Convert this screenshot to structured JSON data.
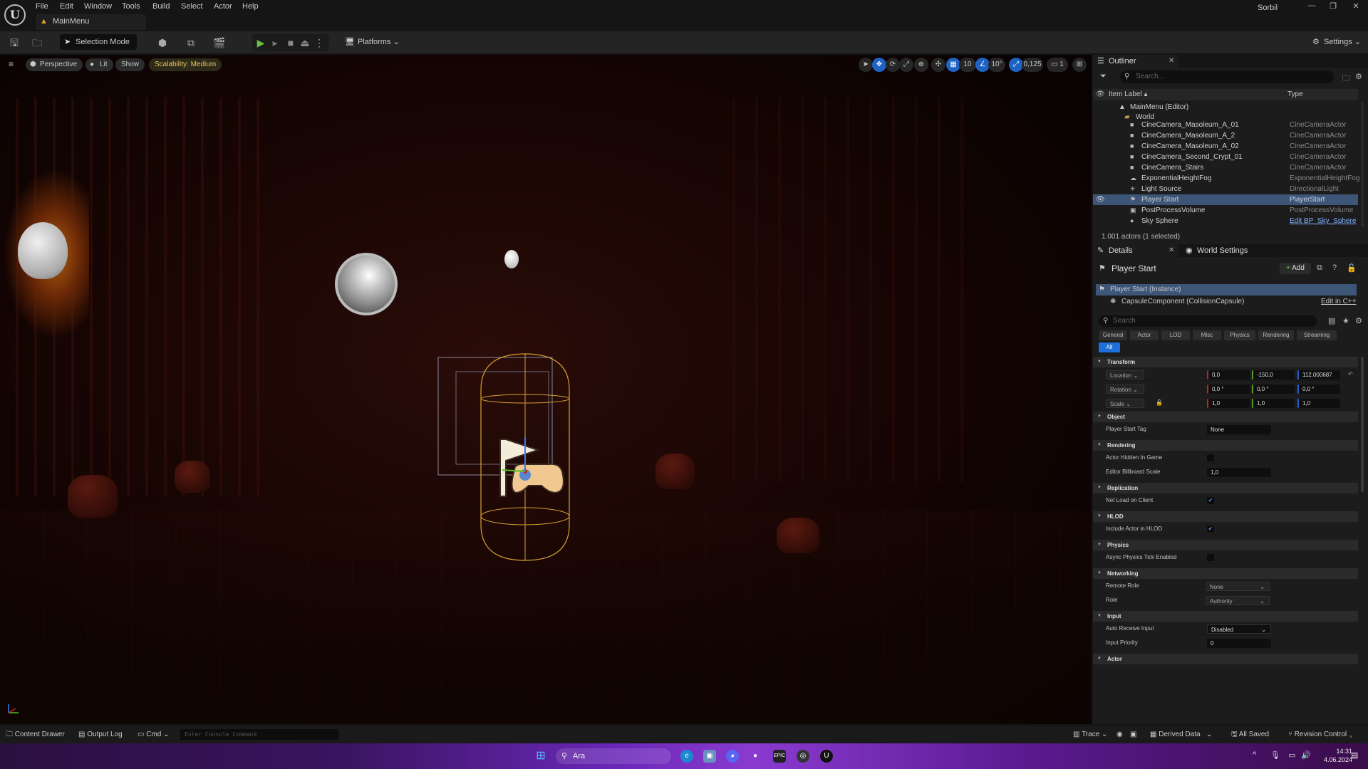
{
  "app": {
    "title": "MainMenu",
    "user": "Sorbil"
  },
  "menu": [
    "File",
    "Edit",
    "Window",
    "Tools",
    "Build",
    "Select",
    "Actor",
    "Help"
  ],
  "window_controls": {
    "minimize": "—",
    "restore": "❐",
    "close": "✕"
  },
  "toolbar": {
    "selection_mode": "Selection Mode",
    "platforms": "Platforms",
    "settings": "Settings"
  },
  "viewport": {
    "view_mode": "Perspective",
    "lighting": "Lit",
    "show": "Show",
    "scalability": "Scalability: Medium",
    "grid_snap": "10",
    "rotation_snap": "10°",
    "scale_snap": "0,125",
    "camera_speed": "1"
  },
  "outliner": {
    "tab": "Outliner",
    "search_placeholder": "Search...",
    "col_label": "Item Label",
    "col_type": "Type",
    "root": "MainMenu (Editor)",
    "folder": "World",
    "rows": [
      {
        "name": "CineCamera_Masoleum_A_01",
        "type": "CineCameraActor"
      },
      {
        "name": "CineCamera_Masoleum_A_2",
        "type": "CineCameraActor"
      },
      {
        "name": "CineCamera_Masoleum_A_02",
        "type": "CineCameraActor"
      },
      {
        "name": "CineCamera_Second_Crypt_01",
        "type": "CineCameraActor"
      },
      {
        "name": "CineCamera_Stairs",
        "type": "CineCameraActor"
      },
      {
        "name": "ExponentialHeightFog",
        "type": "ExponentialHeightFog"
      },
      {
        "name": "Light Source",
        "type": "DirectionalLight"
      },
      {
        "name": "Player Start",
        "type": "PlayerStart",
        "selected": true
      },
      {
        "name": "PostProcessVolume",
        "type": "PostProcessVolume"
      },
      {
        "name": "Sky Sphere",
        "type": "Edit BP_Sky_Sphere",
        "link": true
      }
    ],
    "status": "1.001 actors (1 selected)"
  },
  "details": {
    "tab": "Details",
    "tab2": "World Settings",
    "actor_name": "Player Start",
    "add_label": "Add",
    "instance": "Player Start (Instance)",
    "component": "CapsuleComponent (CollisionCapsule)",
    "edit_cpp": "Edit in C++",
    "search_placeholder": "Search",
    "categories": [
      "General",
      "Actor",
      "LOD",
      "Misc",
      "Physics",
      "Rendering",
      "Streaming"
    ],
    "category_all": "All",
    "transform": {
      "section": "Transform",
      "location_label": "Location",
      "location": [
        "0,0",
        "-150,0",
        "112,000687"
      ],
      "rotation_label": "Rotation",
      "rotation": [
        "0,0 °",
        "0,0 °",
        "0,0 °"
      ],
      "scale_label": "Scale",
      "scale": [
        "1,0",
        "1,0",
        "1,0"
      ]
    },
    "object": {
      "section": "Object",
      "player_start_tag_label": "Player Start Tag",
      "player_start_tag": "None"
    },
    "rendering": {
      "section": "Rendering",
      "hidden_label": "Actor Hidden In Game",
      "hidden": false,
      "billboard_label": "Editor Billboard Scale",
      "billboard": "1,0"
    },
    "replication": {
      "section": "Replication",
      "net_load_label": "Net Load on Client",
      "net_load": true
    },
    "hlod": {
      "section": "HLOD",
      "include_label": "Include Actor in HLOD",
      "include": true
    },
    "physics": {
      "section": "Physics",
      "async_label": "Async Physics Tick Enabled",
      "async": false
    },
    "networking": {
      "section": "Networking",
      "remote_role_label": "Remote Role",
      "remote_role": "None",
      "role_label": "Role",
      "role": "Authority"
    },
    "input": {
      "section": "Input",
      "auto_receive_label": "Auto Receive Input",
      "auto_receive": "Disabled",
      "priority_label": "Input Priority",
      "priority": "0"
    },
    "actor": {
      "section": "Actor"
    }
  },
  "statusbar": {
    "content_drawer": "Content Drawer",
    "output_log": "Output Log",
    "cmd": "Cmd",
    "console_placeholder": "Enter Console Command",
    "trace": "Trace",
    "derived_data": "Derived Data",
    "all_saved": "All Saved",
    "revision_control": "Revision Control"
  },
  "taskbar": {
    "search": "Ara",
    "time": "14:31",
    "date": "4.06.2024"
  }
}
